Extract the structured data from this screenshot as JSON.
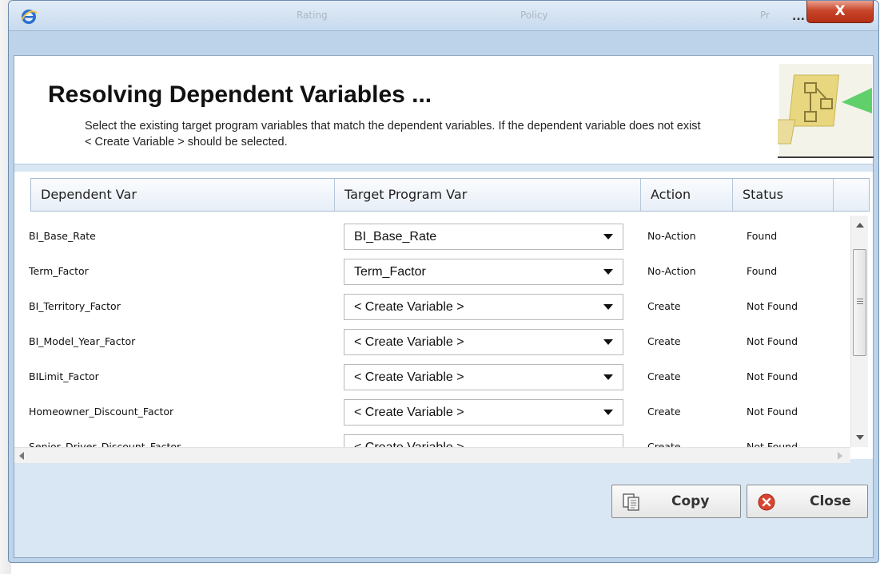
{
  "window": {
    "title_ellipsis": "...",
    "close_glyph": "X",
    "ghost_tabs": [
      "Rating",
      "Policy",
      "Pr"
    ]
  },
  "header": {
    "title": "Resolving Dependent Variables ...",
    "description": "Select the existing target program variables that match the dependent variables. If the dependent variable does not exist < Create Variable > should be selected."
  },
  "grid": {
    "columns": [
      "Dependent Var",
      "Target Program Var",
      "Action",
      "Status"
    ],
    "rows": [
      {
        "dependent": "BI_Base_Rate",
        "target": "BI_Base_Rate",
        "action": "No-Action",
        "status": "Found"
      },
      {
        "dependent": "Term_Factor",
        "target": "Term_Factor",
        "action": "No-Action",
        "status": "Found"
      },
      {
        "dependent": "BI_Territory_Factor",
        "target": "< Create Variable >",
        "action": "Create",
        "status": "Not Found"
      },
      {
        "dependent": "BI_Model_Year_Factor",
        "target": "< Create Variable >",
        "action": "Create",
        "status": "Not Found"
      },
      {
        "dependent": "BILimit_Factor",
        "target": "< Create Variable >",
        "action": "Create",
        "status": "Not Found"
      },
      {
        "dependent": "Homeowner_Discount_Factor",
        "target": "< Create Variable >",
        "action": "Create",
        "status": "Not Found"
      },
      {
        "dependent": "Senior_Driver_Discount_Factor",
        "target": "< Create Variable >",
        "action": "Create",
        "status": "Not Found"
      }
    ]
  },
  "buttons": {
    "copy": "Copy",
    "close": "Close"
  },
  "icons": [
    "ie-icon",
    "wizard-art-icon",
    "copy-icon",
    "close-circle-icon"
  ],
  "colors": {
    "window_bg": "#bcd3e9",
    "close_red": "#c9462a"
  }
}
